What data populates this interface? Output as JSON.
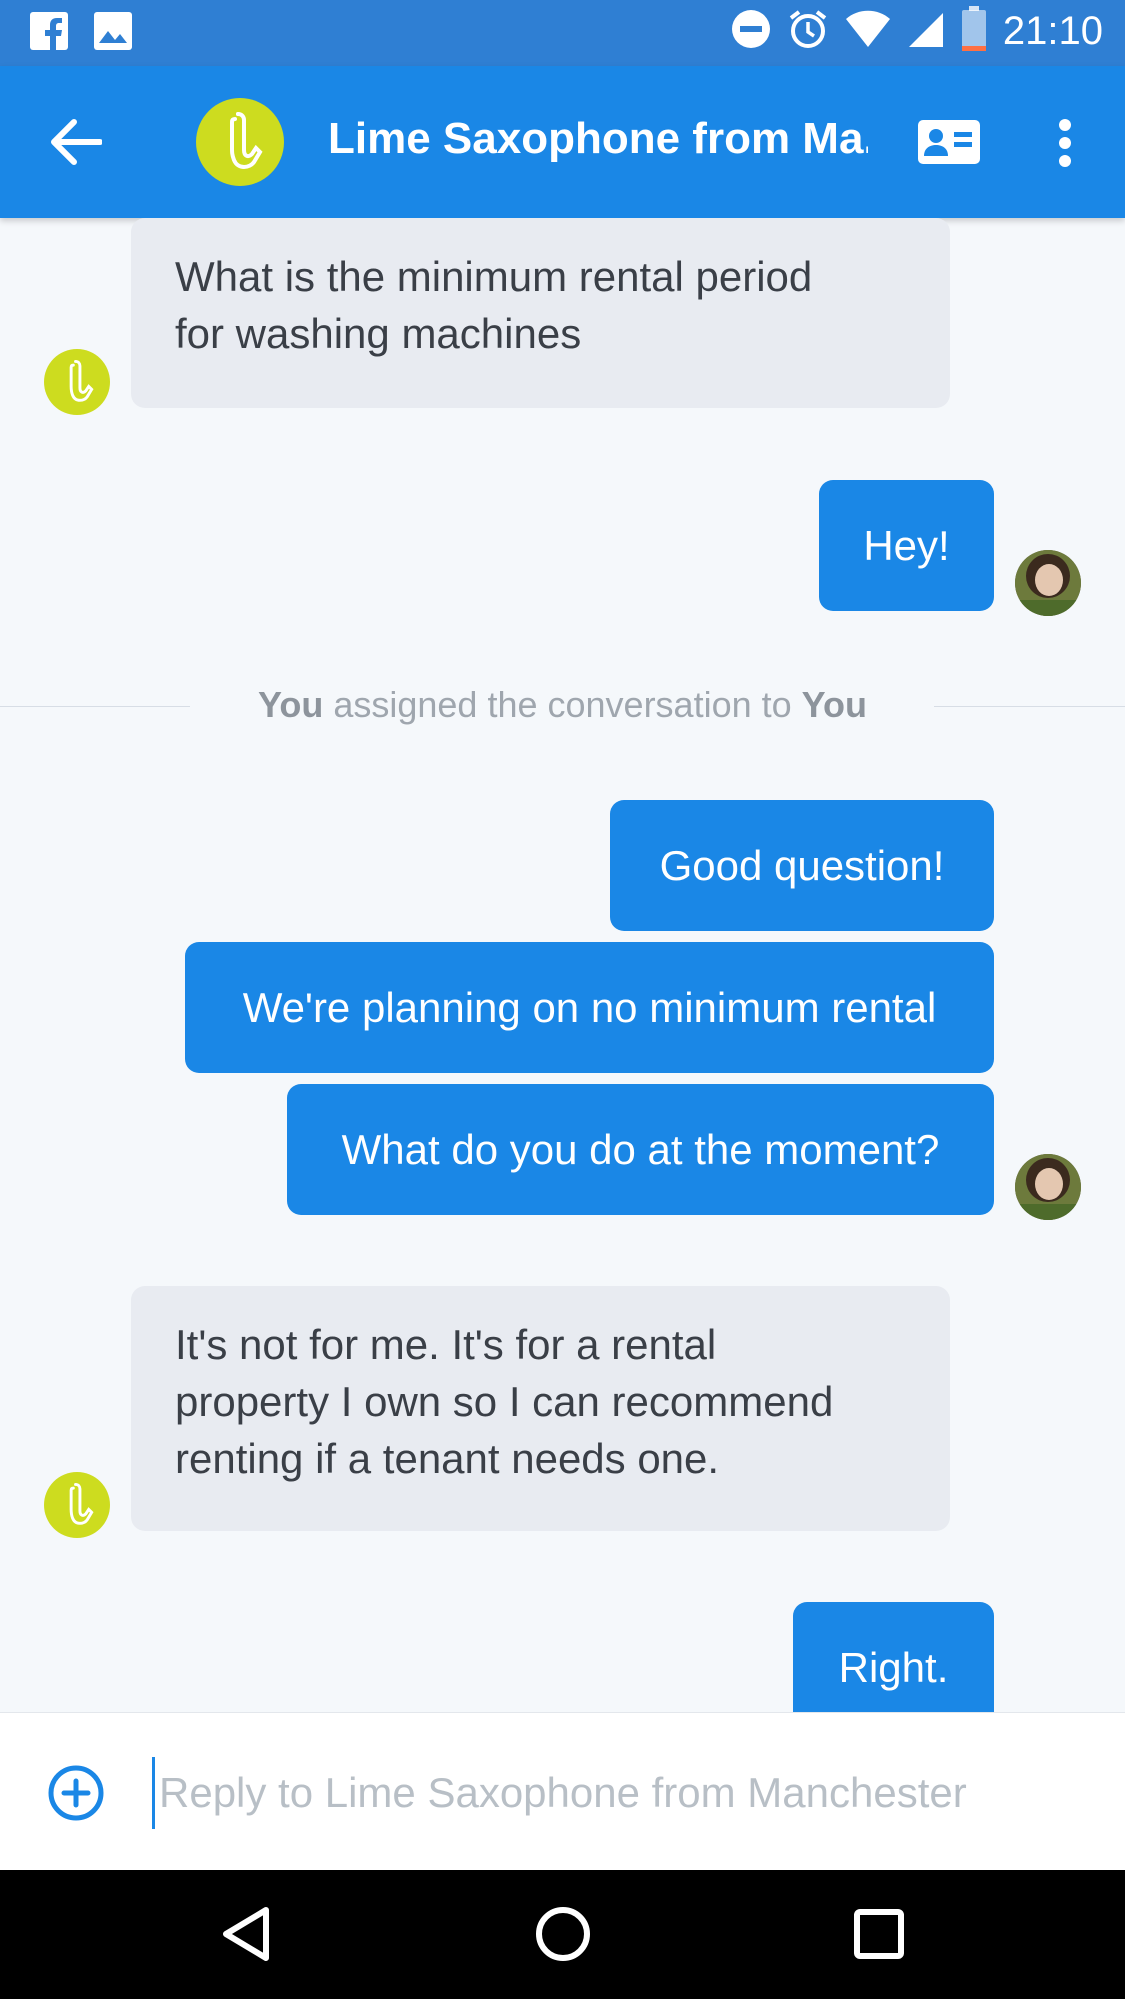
{
  "status_bar": {
    "time": "21:10",
    "left_icons": [
      "facebook-icon",
      "image-icon"
    ],
    "right_icons": [
      "do-not-disturb-icon",
      "alarm-icon",
      "wifi-icon",
      "signal-icon",
      "battery-icon"
    ]
  },
  "app_bar": {
    "title": "Lime Saxophone from Ma...",
    "back_icon": "arrow-back-icon",
    "contact_icon": "contact-card-icon",
    "more_icon": "more-vert-icon",
    "avatar_icon": "saxophone-icon",
    "brand_color": "#1a87e6",
    "avatar_color": "#cddc1f"
  },
  "messages": [
    {
      "from": "contact",
      "lines": [
        "What is the minimum rental period",
        "for washing machines"
      ]
    },
    {
      "from": "you",
      "text": "Hey!"
    },
    {
      "from": "you",
      "text": "Good question!"
    },
    {
      "from": "you",
      "text": "We're planning on no minimum rental"
    },
    {
      "from": "you",
      "text": "What do you do at the moment?"
    },
    {
      "from": "contact",
      "lines": [
        "It's not for me. It's for a rental",
        "property I own so I can recommend",
        "renting if a tenant needs one."
      ]
    },
    {
      "from": "you",
      "text": "Right."
    }
  ],
  "system_note": {
    "actor": "You",
    "middle": " assigned the conversation to ",
    "target": "You"
  },
  "composer": {
    "placeholder": "Reply to Lime Saxophone from Manchester",
    "add_icon": "add-circle-icon"
  },
  "nav_bar": {
    "icons": [
      "nav-back-icon",
      "nav-home-icon",
      "nav-recents-icon"
    ]
  }
}
